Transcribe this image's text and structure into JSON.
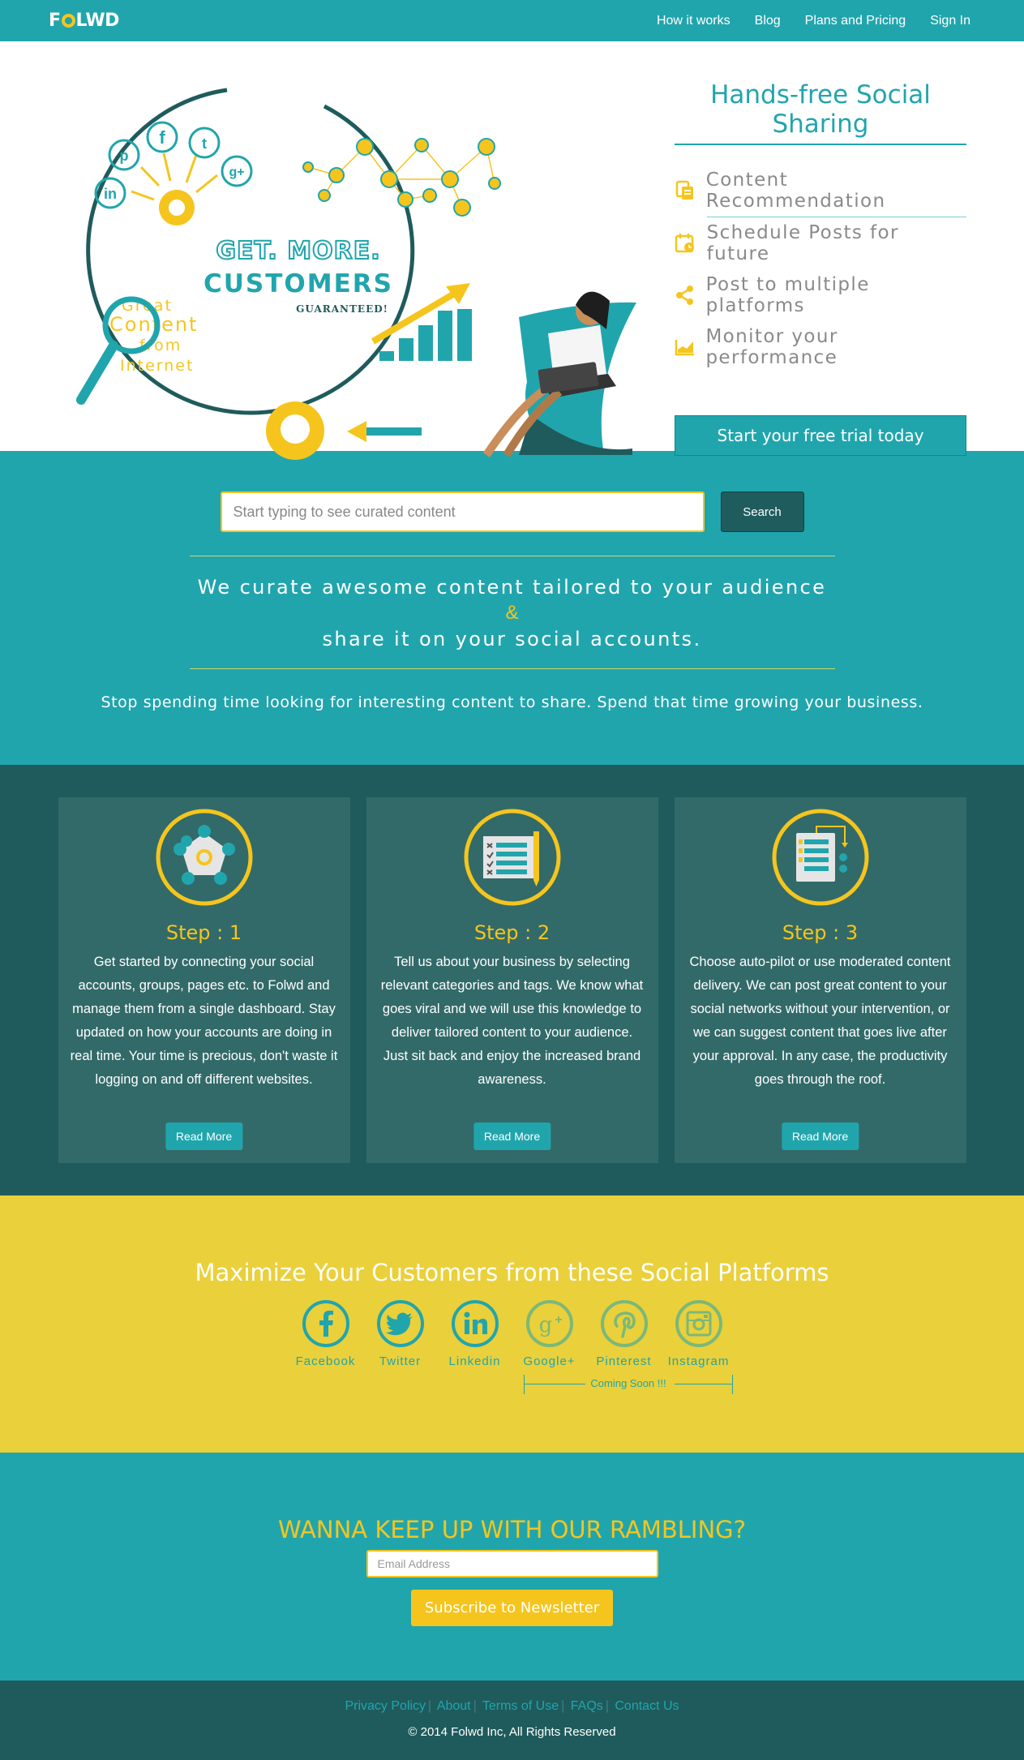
{
  "brand": {
    "name": "FOLWD",
    "accent": "#21a5ad",
    "dark": "#1f5b5c",
    "yellow": "#f5c51e"
  },
  "nav": {
    "links": [
      "How it works",
      "Blog",
      "Plans and Pricing",
      "Sign In"
    ]
  },
  "hero": {
    "title": "Hands-free Social Sharing",
    "art": {
      "line1": "GET. MORE.",
      "line2": "CUSTOMERS",
      "line3": "GUARANTEED!",
      "magnifier_text": [
        "Great",
        "Content",
        "from",
        "Internet"
      ]
    },
    "features": [
      {
        "icon": "content-recommendation-icon",
        "label": "Content Recommendation"
      },
      {
        "icon": "calendar-schedule-icon",
        "label": "Schedule Posts for future"
      },
      {
        "icon": "share-icon",
        "label": "Post to multiple platforms"
      },
      {
        "icon": "chart-icon",
        "label": "Monitor your performance"
      }
    ],
    "cta": "Start your free trial today"
  },
  "curate": {
    "search_placeholder": "Start typing to see curated content",
    "search_button": "Search",
    "headline_1": "We curate awesome content tailored to your audience",
    "amp": "&",
    "headline_2": "share it on your social accounts.",
    "subtext": "Stop spending time looking for interesting content to share. Spend that time growing your business."
  },
  "steps": [
    {
      "icon": "network-icon",
      "title": "Step : 1",
      "text": "Get started by connecting your social accounts, groups, pages etc. to Folwd and manage them from a single dashboard. Stay updated on how your accounts are doing in real time. Your time is precious, don't waste it logging on and off different websites.",
      "button": "Read More"
    },
    {
      "icon": "checklist-icon",
      "title": "Step : 2",
      "text": "Tell us about your business by selecting relevant categories and tags. We know what goes viral and we will use this knowledge to deliver tailored content to your audience. Just sit back and enjoy the increased brand awareness.",
      "button": "Read More"
    },
    {
      "icon": "content-delivery-icon",
      "title": "Step : 3",
      "text": "Choose auto-pilot or use moderated content delivery. We can post great content to your social networks without your intervention, or we can suggest content that goes live after your approval. In any case, the productivity goes through the roof.",
      "button": "Read More"
    }
  ],
  "social": {
    "title": "Maximize Your Customers from these Social Platforms",
    "platforms": [
      {
        "icon": "facebook-icon",
        "label": "Facebook"
      },
      {
        "icon": "twitter-icon",
        "label": "Twitter"
      },
      {
        "icon": "linkedin-icon",
        "label": "Linkedin"
      },
      {
        "icon": "googleplus-icon",
        "label": "Google+"
      },
      {
        "icon": "pinterest-icon",
        "label": "Pinterest"
      },
      {
        "icon": "instagram-icon",
        "label": "Instagram"
      }
    ],
    "coming_soon": "Coming Soon !!!"
  },
  "newsletter": {
    "title": "WANNA KEEP UP WITH OUR RAMBLING?",
    "email_placeholder": "Email Address",
    "button": "Subscribe to Newsletter"
  },
  "footer": {
    "links": [
      "Privacy Policy",
      "About",
      "Terms of Use",
      "FAQs",
      "Contact Us"
    ],
    "copyright": "© 2014 Folwd Inc, All Rights Reserved"
  }
}
